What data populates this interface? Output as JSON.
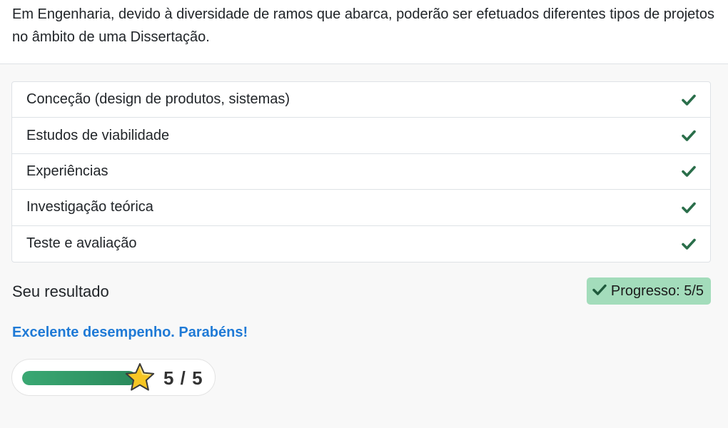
{
  "intro": {
    "text": "Em Engenharia, devido à diversidade de ramos que abarca, poderão ser efetuados diferentes tipos de projetos no âmbito de uma Dissertação."
  },
  "options": [
    {
      "label": "Conceção (design de produtos, sistemas)",
      "checked": true
    },
    {
      "label": "Estudos de viabilidade",
      "checked": true
    },
    {
      "label": "Experiências",
      "checked": true
    },
    {
      "label": "Investigação teórica",
      "checked": true
    },
    {
      "label": "Teste e avaliação",
      "checked": true
    }
  ],
  "result": {
    "title": "Seu resultado",
    "progress_label": "Progresso: 5/5",
    "feedback": "Excelente desempenho. Parabéns!",
    "score": 5,
    "max_score": 5,
    "score_text": "5 / 5",
    "progress_fraction": 1.0
  },
  "colors": {
    "check": "#2a6e4a",
    "badge_bg": "#a3dcbb",
    "feedback": "#1f7ad6",
    "bar": "#2f9a67",
    "star": "#f6c624"
  },
  "icons": {
    "option_check": "check-icon",
    "badge_check": "check-icon",
    "score_star": "star-icon"
  }
}
